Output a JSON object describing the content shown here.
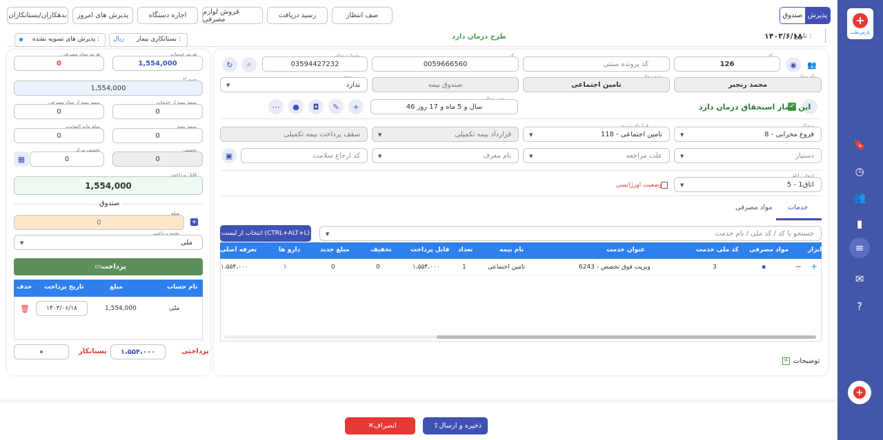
{
  "brand": {
    "logo_text": "پارس‌طب"
  },
  "rail_icons": [
    "bookmark-add-icon",
    "clock-icon",
    "users-icon",
    "bar-chart-icon",
    "menu-icon",
    "mail-icon",
    "help-icon"
  ],
  "top": {
    "seg_on": "پذیرش",
    "seg_off": "صندوق",
    "buttons": [
      "صف انتظار",
      "رسید دریافت",
      "فروش لوازم مصرفی",
      "اجاره دستگاه",
      "پذیرش های امروز",
      "بدهکاران/بستانکاران"
    ]
  },
  "info": {
    "date_label": "تاریخ :",
    "date": "۱۴۰۳/۶/۱۸",
    "plan_text": "طرح درمان دارد",
    "creditor_label": "بستانکاری بیمار :",
    "creditor_value": "ریال",
    "unsettled_label": "پذیرش های تسویه نشده :"
  },
  "patient": {
    "code_label": "کد بیمار",
    "code": "126",
    "file_ph": "کد پرونده سنتی",
    "national_label": "کد ملی",
    "national": "0059666560",
    "phone_label": "شماره تماس",
    "phone": "03594427232",
    "name_label": "نام بیمار",
    "name": "محمد رنجبر",
    "insurer_label": "بیمه بیمار",
    "insurer": "تامین اجتماعی",
    "insurance_fund": "صندوق بیمه",
    "sup_label": "بیمه تکمیلی",
    "sup": "ندارد",
    "eligible_text": "این بیمار استحقاق درمان دارد",
    "age_label": "سن بیمار",
    "age": "46 سال و 5 ماه و 17 روز"
  },
  "admission": {
    "doctor_label": "پزشک",
    "doctor": "8 - فروغ محرابی",
    "contract_label": "قرارداد پذیرش",
    "contract": "118 - تامین اجتماعی",
    "sup_contract": "قرارداد بیمه تکمیلی",
    "sup_cap": "سقف پرداخت بیمه تکمیلی",
    "assistant_ph": "دستیار",
    "reason_ph": "علت مراجعه",
    "referrer_ph": "نام معرف",
    "health_ph": "کد ارجاع سلامت",
    "room_label": "انتخاب اتاق",
    "room": "5 - اتاق1",
    "emergency": "وضعیت اورژانسی"
  },
  "tabs": {
    "services": "خدمات",
    "supplies": "مواد مصرفی"
  },
  "search": {
    "placeholder": "جستجو با کد / کد ملی / نام خدمت",
    "pick_btn": "انتخاب از لیست (CTRL+ALT+L)"
  },
  "table": {
    "headers": [
      "ابزار",
      "مواد مصرفی",
      "کد ملی خدمت",
      "عنوان خدمت",
      "نام بیمه",
      "تعداد",
      "قابل پرداخت",
      "تخفیف",
      "مبلغ جدید",
      "دارو ها",
      "تعرفه اصلی"
    ],
    "row": {
      "national": "3",
      "title": "6243 - ویزیت فوق تخصص",
      "insurer": "تامین اجتماعی",
      "count": "1",
      "payable": "۱،۵۵۴،۰۰۰",
      "discount": "0",
      "new_amount": "0",
      "base": "۱،۵۵۴،۰۰۰"
    }
  },
  "notes": "توضیحات",
  "finance": {
    "service_cost_label": "هزینه خدمات",
    "service_cost": "1,554,000",
    "supply_cost_label": "هزینه مواد مصرفی",
    "supply_cost": "0",
    "total_label": "جمع کل",
    "total": "1,554,000",
    "ins_service_label": "سهم بیمه از خدمات",
    "ins_service": "0",
    "ins_supply_label": "سهم بیمه از مواد مصرفی",
    "ins_supply": "0",
    "sup_share_label": "سهم بیمه تکمیلی",
    "sup_share": "0",
    "diff_label": "مبلغ مابه التفاوت",
    "diff": "0",
    "svc_discount_label": "تخفیف خدمات",
    "svc_discount": "0",
    "center_discount_label": "تخفیف مرکز",
    "center_discount": "0",
    "payable_label": "قابل پرداخت",
    "payable": "1,554,000",
    "cashbox_title": "صندوق",
    "amount_label": "مبلغ",
    "amount": "0",
    "method_label": "نحوه پرداخت",
    "method": "ملی",
    "pay_btn": "پرداخت",
    "pay_headers": [
      "نام حساب",
      "مبلغ",
      "تاریخ پرداخت",
      "حذف"
    ],
    "pay_row": {
      "account": "ملی",
      "amount": "1,554,000",
      "date": "۱۴۰۳/۰۶/۱۸"
    },
    "paid_label": "پرداختی",
    "paid": "۱،۵۵۴،۰۰۰",
    "creditor_label": "بستانکار"
  },
  "footer": {
    "save": "ذخیره و ارسال",
    "cancel": "انصراف"
  },
  "colors": {
    "primary": "#3f51b5",
    "danger": "#e53935",
    "success": "#5c8f5c",
    "rail": "#4356a8"
  }
}
